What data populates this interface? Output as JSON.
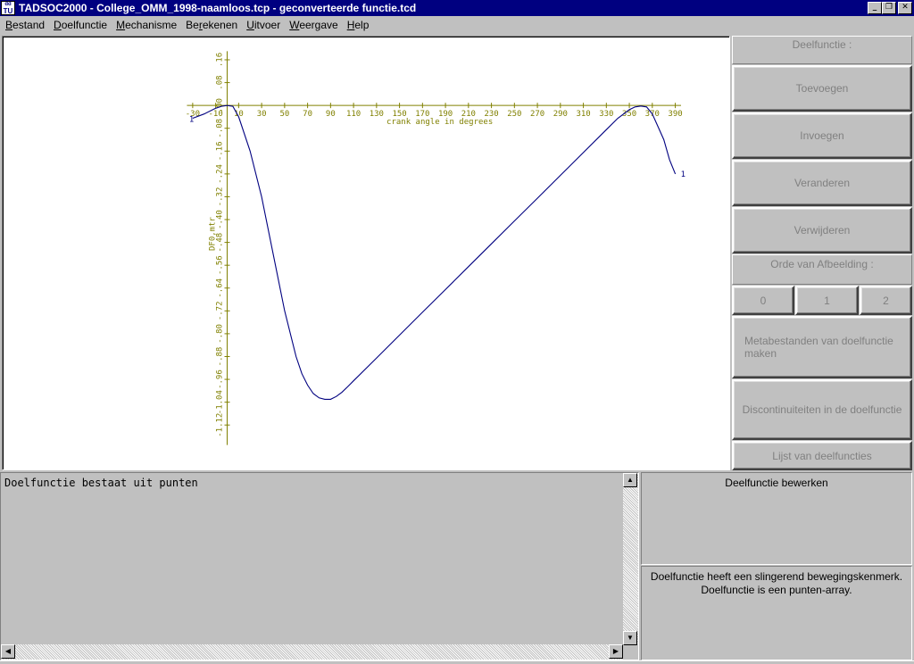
{
  "window": {
    "title": "TADSOC2000 - College_OMM_1998-naamloos.tcp - geconverteerde functie.tcd",
    "icon_top": "dd",
    "icon_bottom": "TU",
    "minimize_icon": "minimize-icon",
    "maximize_icon": "restore-icon",
    "close_icon": "close-icon"
  },
  "menu": [
    {
      "label": "Bestand",
      "key": "B",
      "rest": "estand"
    },
    {
      "label": "Doelfunctie",
      "key": "D",
      "rest": "oelfunctie"
    },
    {
      "label": "Mechanisme",
      "key": "M",
      "rest": "echanisme"
    },
    {
      "label": "Berekenen",
      "pre": "Be",
      "key": "r",
      "rest": "ekenen"
    },
    {
      "label": "Uitvoer",
      "key": "U",
      "rest": "itvoer"
    },
    {
      "label": "Weergave",
      "key": "W",
      "rest": "eergave"
    },
    {
      "label": "Help",
      "key": "H",
      "rest": "elp"
    }
  ],
  "right_panel": {
    "header": "Deelfunctie :",
    "add": "Toevoegen",
    "insert": "Invoegen",
    "change": "Veranderen",
    "remove": "Verwijderen",
    "order_label": "Orde van Afbeelding :",
    "order_0": "0",
    "order_1": "1",
    "order_2": "2",
    "metafiles": "Metabestanden van doelfunctie maken",
    "discontinuities": "Discontinuiteiten in de doelfunctie",
    "list": "Lijst van deelfuncties"
  },
  "log": {
    "text": "Doelfunctie bestaat uit punten"
  },
  "edit_panel": {
    "title": "Deelfunctie bewerken",
    "info_line1": "Doelfunctie heeft een slingerend bewegingskenmerk.",
    "info_line2": "Doelfunctie is een punten-array."
  },
  "colors": {
    "axis": "#808000",
    "curve": "#000080",
    "titlebar": "#000080"
  },
  "chart_data": {
    "type": "line",
    "xlabel": "crank angle in degrees",
    "ylabel": "DF0,mtr",
    "xlim": [
      -40,
      395
    ],
    "ylim": [
      -1.16,
      0.16
    ],
    "x_ticks": [
      -30,
      -10,
      10,
      30,
      50,
      70,
      90,
      110,
      130,
      150,
      170,
      190,
      210,
      230,
      250,
      270,
      290,
      310,
      330,
      350,
      370,
      390
    ],
    "x_tick_labels": [
      "-30",
      "-10",
      "10",
      "30",
      "50",
      "70",
      "90",
      "110",
      "130",
      "150",
      "170",
      "190",
      "210",
      "230",
      "250",
      "270",
      "290",
      "310",
      "330",
      "350",
      "370",
      "390"
    ],
    "y_ticks": [
      0.16,
      0.08,
      0.0,
      -0.08,
      -0.16,
      -0.24,
      -0.32,
      -0.4,
      -0.48,
      -0.56,
      -0.64,
      -0.72,
      -0.8,
      -0.88,
      -0.96,
      -1.04,
      -1.12
    ],
    "y_tick_labels": [
      ".16",
      ".08",
      ".00",
      "-.08",
      "-.16",
      "-.24",
      "-.32",
      "-.40",
      "-.48",
      "-.56",
      "-.64",
      "-.72",
      "-.80",
      "-.88",
      "-.96",
      "-1.04",
      "-1.12"
    ],
    "series": [
      {
        "x": [
          -30,
          -20,
          -10,
          -5,
          0,
          5,
          10,
          20,
          30,
          40,
          50,
          60,
          65,
          70,
          75,
          80,
          85,
          90,
          95,
          100,
          105,
          110,
          130,
          150,
          170,
          190,
          210,
          230,
          250,
          270,
          290,
          310,
          330,
          340,
          350,
          355,
          360,
          365,
          370,
          375,
          380,
          385,
          390
        ],
        "y": [
          -0.045,
          -0.03,
          -0.01,
          -0.003,
          0.0,
          -0.003,
          -0.04,
          -0.16,
          -0.32,
          -0.52,
          -0.72,
          -0.88,
          -0.94,
          -0.98,
          -1.01,
          -1.025,
          -1.03,
          -1.03,
          -1.02,
          -1.005,
          -0.985,
          -0.965,
          -0.885,
          -0.805,
          -0.725,
          -0.645,
          -0.565,
          -0.485,
          -0.405,
          -0.325,
          -0.245,
          -0.165,
          -0.085,
          -0.045,
          -0.015,
          -0.005,
          -0.002,
          -0.005,
          -0.03,
          -0.075,
          -0.12,
          -0.19,
          -0.24
        ]
      }
    ],
    "end_marker_label": "1"
  }
}
